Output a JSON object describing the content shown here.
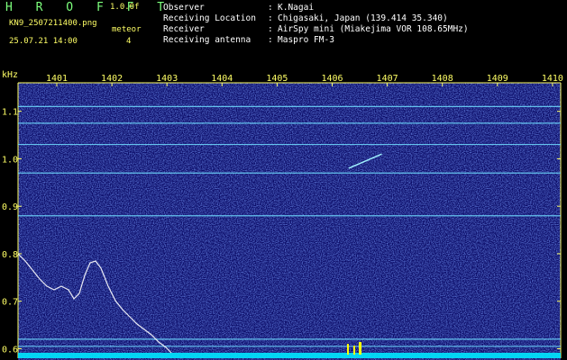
{
  "header": {
    "brand": "H R O F F T",
    "version": "1.0.0f",
    "filename": "KN9_2507211400.png",
    "meteor_label": "meteor",
    "meteor_count": "4",
    "datetime": "25.07.21 14:00",
    "info": [
      {
        "key": "Observer",
        "value": "K.Nagai"
      },
      {
        "key": "Receiving Location",
        "value": "Chigasaki, Japan (139.414 35.340)"
      },
      {
        "key": "Receiver",
        "value": "AirSpy mini (Miakejima VOR 108.65MHz)"
      },
      {
        "key": "Receiving antenna",
        "value": "Maspro FM-3"
      }
    ]
  },
  "chart_data": {
    "type": "heatmap",
    "ylabel": "kHz",
    "x_ticks": [
      "1401",
      "1402",
      "1403",
      "1404",
      "1405",
      "1406",
      "1407",
      "1408",
      "1409",
      "1410"
    ],
    "y_ticks": [
      "1.1",
      "1.0",
      "0.9",
      "0.8",
      "0.7",
      "0.6"
    ],
    "ylim": [
      0.58,
      1.16
    ],
    "carrier_lines_khz": [
      1.11,
      1.075,
      1.03,
      0.97,
      0.88,
      0.62,
      0.605
    ],
    "meteor_echo": {
      "x_start": "1406.3",
      "x_end": "1406.9",
      "y_start": 0.98,
      "y_end": 1.01
    },
    "colors": {
      "background": "#0a0a66",
      "noise": "#3a5adc",
      "carrier": "#6fdcff",
      "axis": "#ffff66",
      "baseline": "#00e8ff"
    }
  }
}
